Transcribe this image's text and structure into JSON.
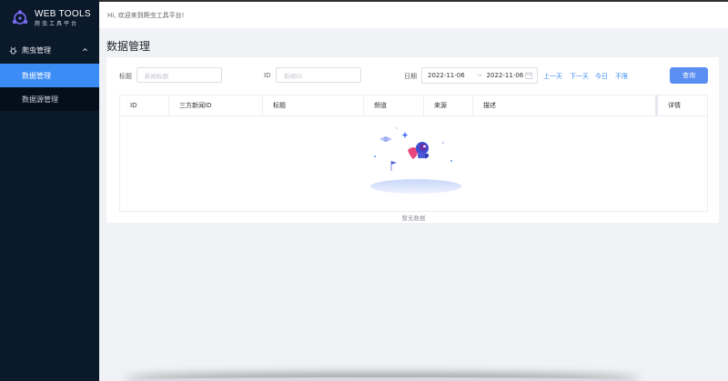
{
  "brand": {
    "title": "WEB TOOLS",
    "subtitle": "爬虫工具平台",
    "logo_icon": "spider-logo-icon"
  },
  "sidebar": {
    "group_label": "爬虫管理",
    "group_icon": "bug-icon",
    "items": [
      {
        "label": "数据管理",
        "active": true
      },
      {
        "label": "数据源管理",
        "active": false
      }
    ]
  },
  "header": {
    "greeting": "Hi, 欢迎来到爬虫工具平台!"
  },
  "page": {
    "title": "数据管理"
  },
  "filters": {
    "title_label": "标题",
    "title_placeholder": "新闻标题",
    "id_label": "ID",
    "id_placeholder": "新闻ID",
    "date_label": "日期",
    "date_start": "2022-11-06",
    "date_separator": "→",
    "date_end": "2022-11-06",
    "quick": [
      "上一天",
      "下一天",
      "今日",
      "不限"
    ],
    "query_button": "查询"
  },
  "table": {
    "columns": [
      "ID",
      "三方新闻ID",
      "标题",
      "频道",
      "来源",
      "描述",
      "详情"
    ],
    "rows": [],
    "empty_text": "暂无数据"
  },
  "colors": {
    "sidebar_bg": "#0b1a2b",
    "active_item": "#3b8cf4",
    "primary_button": "#5a8ef0",
    "link": "#3b8cf4"
  }
}
